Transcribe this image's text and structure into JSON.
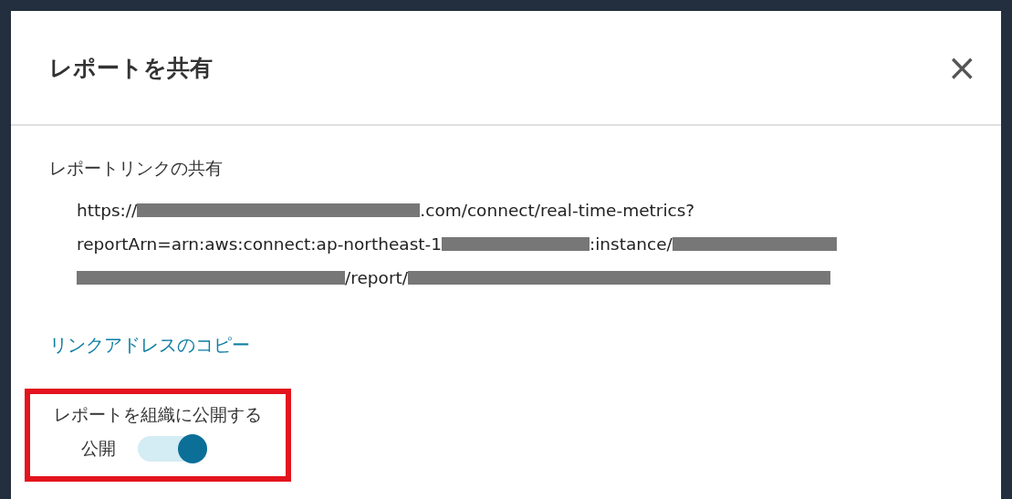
{
  "dialog": {
    "title": "レポートを共有",
    "close": "×"
  },
  "share_link": {
    "heading": "レポートリンクの共有",
    "url_lines": [
      [
        {
          "kind": "text",
          "text": "https://"
        },
        {
          "kind": "redacted"
        },
        {
          "kind": "text",
          "text": ".com/connect/real-time-metrics?"
        }
      ],
      [
        {
          "kind": "text",
          "text": "reportArn=arn:aws:connect:ap-northeast-1"
        },
        {
          "kind": "redacted"
        },
        {
          "kind": "text",
          "text": ":instance/"
        },
        {
          "kind": "redacted"
        }
      ],
      [
        {
          "kind": "redacted"
        },
        {
          "kind": "text",
          "text": "/report/"
        },
        {
          "kind": "redacted"
        }
      ]
    ],
    "copy_link": "リンクアドレスのコピー"
  },
  "publish": {
    "heading": "レポートを組織に公開する",
    "highlighted": true,
    "toggle": {
      "label": "公開",
      "on": true
    }
  }
}
